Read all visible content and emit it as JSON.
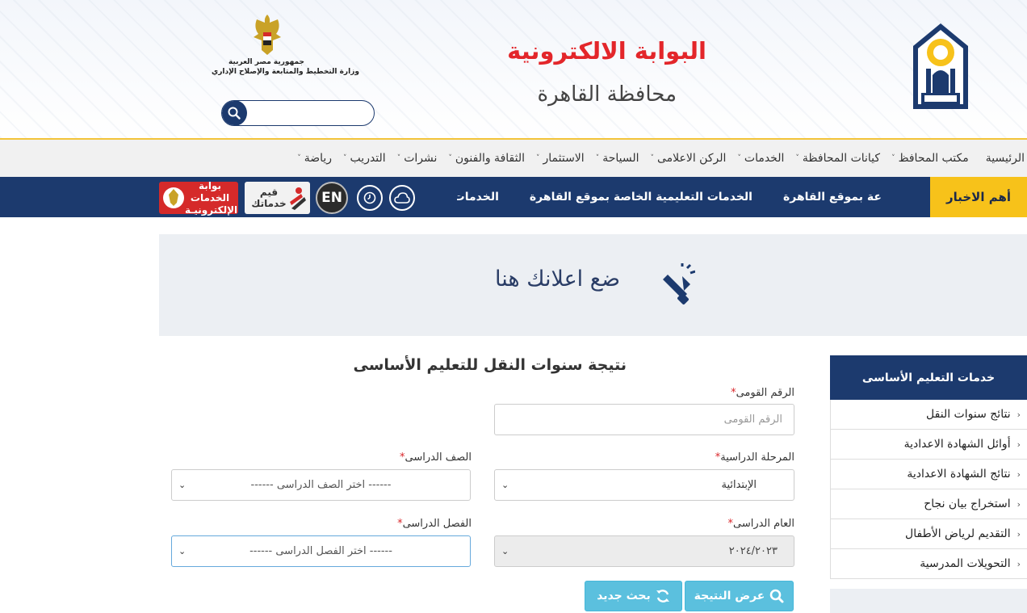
{
  "header": {
    "title_main": "البوابة الالكترونية",
    "title_sub": "محافظة القاهرة",
    "logo_alt_text": "القاهرة",
    "ministry_line1": "جمهورية مصر العربية",
    "ministry_line2": "وزارة التخطيط والمتابعة والإصلاح الإداري",
    "search_placeholder": ""
  },
  "nav": {
    "items": [
      {
        "label": "الرئيسية",
        "dropdown": false
      },
      {
        "label": "مكتب المحافظ",
        "dropdown": true
      },
      {
        "label": "كيانات المحافظة",
        "dropdown": true
      },
      {
        "label": "الخدمات",
        "dropdown": true
      },
      {
        "label": "الركن الاعلامى",
        "dropdown": true
      },
      {
        "label": "السياحة",
        "dropdown": true
      },
      {
        "label": "الاستثمار",
        "dropdown": true
      },
      {
        "label": "الثقافة والفنون",
        "dropdown": true
      },
      {
        "label": "نشرات",
        "dropdown": true
      },
      {
        "label": "التدريب",
        "dropdown": true
      },
      {
        "label": "رياضة",
        "dropdown": true
      }
    ]
  },
  "ticker": {
    "label": "أهم الاخبار",
    "news": [
      "عة بموقع القاهرة",
      "الخدمات التعليمية الخاصة بموقع القاهرة",
      "الخدمات ال"
    ],
    "en_label": "EN",
    "rate_label_1": "قيم",
    "rate_label_2": "خدماتك",
    "portal_label_1": "بوابة الخدمات",
    "portal_label_2": "الإلكترونيـة"
  },
  "ad": {
    "text": "ضع اعلانك هنا"
  },
  "sidebar": {
    "title": "خدمات التعليم الأساسى",
    "items": [
      "نتائج سنوات النقل",
      "أوائل الشهادة الاعدادية",
      "نتائج الشهادة الاعدادية",
      "استخراج بيان نجاح",
      "التقديم لرياض الأطفال",
      "التحويلات المدرسية"
    ]
  },
  "form": {
    "title": "نتيجة سنوات النقل للتعليم الأساسى",
    "national_id_label": "الرقم القومى",
    "national_id_placeholder": "الرقم القومى",
    "stage_label": "المرحلة الدراسية",
    "stage_value": "الإبتدائية",
    "grade_label": "الصف الدراسى",
    "grade_value": "------ اختر الصف الدراسى ------",
    "year_label": "العام الدراسى",
    "year_value": "٢٠٢٤/٢٠٢٣",
    "term_label": "الفصل الدراسى",
    "term_value": "------ اختر الفصل الدراسى ------",
    "show_result_label": "عرض النتيجة",
    "new_search_label": "بحث جديد",
    "required_mark": "*"
  },
  "colors": {
    "navy": "#1c3a6e",
    "accent_yellow": "#f7c21a",
    "title_red": "#e3262a",
    "button_blue": "#5bc0de"
  },
  "icons": [
    "search-icon",
    "cloud-icon",
    "clock-icon",
    "megaphone-icon",
    "refresh-icon",
    "chevron-down-icon",
    "chevron-right-icon"
  ]
}
